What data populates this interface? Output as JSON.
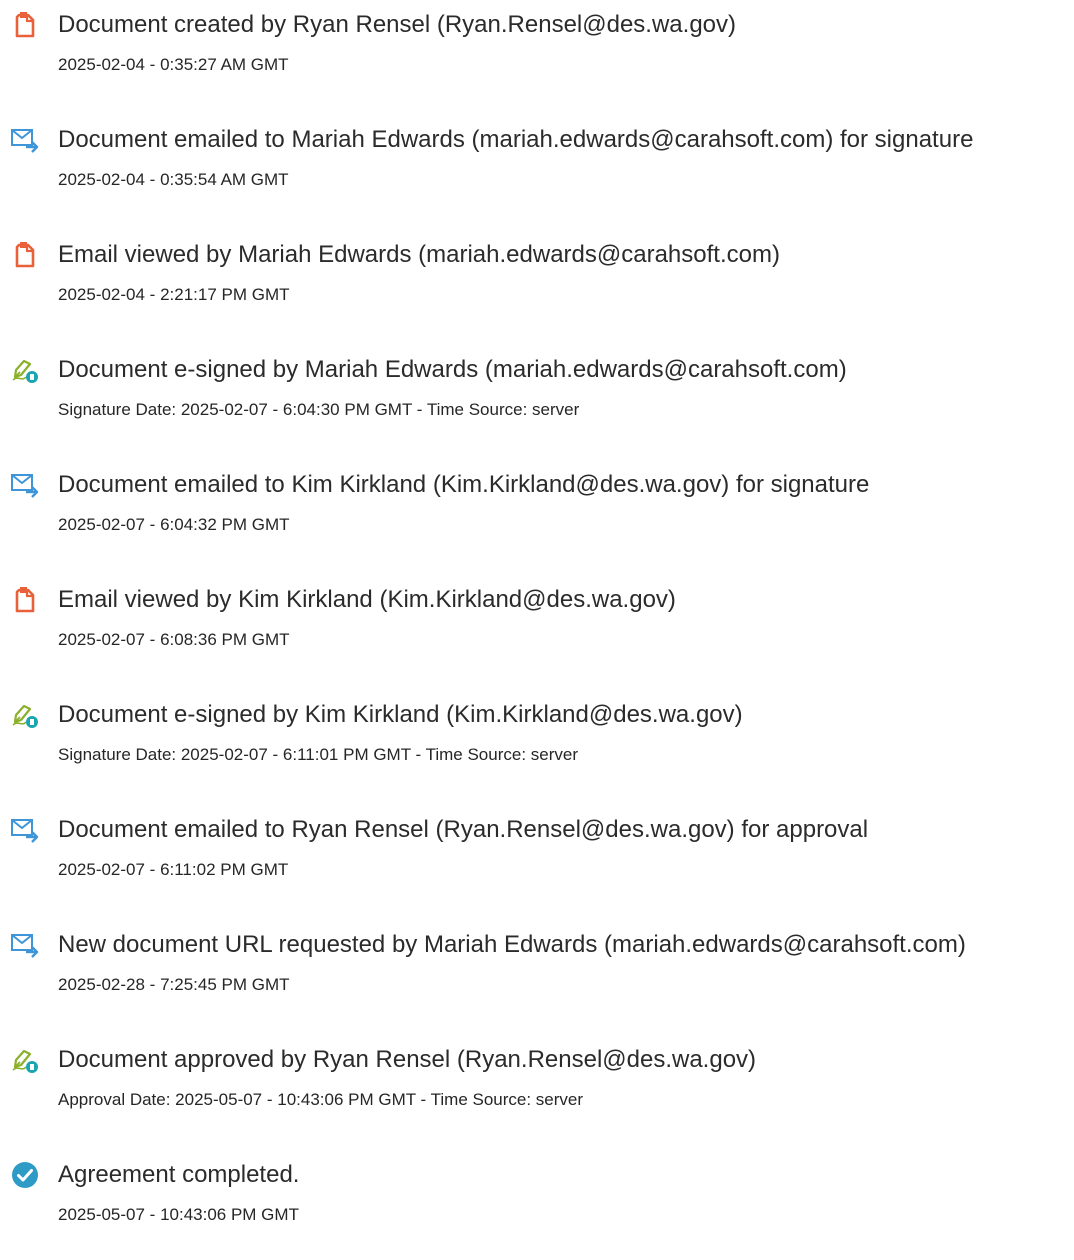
{
  "events": [
    {
      "icon": "document-icon",
      "title": "Document created by Ryan Rensel (Ryan.Rensel@des.wa.gov)",
      "time": "2025-02-04 - 0:35:27 AM GMT"
    },
    {
      "icon": "email-sent-icon",
      "title": "Document emailed to Mariah Edwards (mariah.edwards@carahsoft.com) for signature",
      "time": "2025-02-04 - 0:35:54 AM GMT"
    },
    {
      "icon": "document-icon",
      "title": "Email viewed by Mariah Edwards (mariah.edwards@carahsoft.com)",
      "time": "2025-02-04 - 2:21:17 PM GMT"
    },
    {
      "icon": "e-sign-pen-icon",
      "title": "Document e-signed by Mariah Edwards (mariah.edwards@carahsoft.com)",
      "time": "Signature Date: 2025-02-07 - 6:04:30 PM GMT - Time Source: server"
    },
    {
      "icon": "email-sent-icon",
      "title": "Document emailed to Kim Kirkland (Kim.Kirkland@des.wa.gov) for signature",
      "time": "2025-02-07 - 6:04:32 PM GMT"
    },
    {
      "icon": "document-icon",
      "title": "Email viewed by Kim Kirkland (Kim.Kirkland@des.wa.gov)",
      "time": "2025-02-07 - 6:08:36 PM GMT"
    },
    {
      "icon": "e-sign-pen-icon",
      "title": "Document e-signed by Kim Kirkland (Kim.Kirkland@des.wa.gov)",
      "time": "Signature Date: 2025-02-07 - 6:11:01 PM GMT - Time Source: server"
    },
    {
      "icon": "email-sent-icon",
      "title": "Document emailed to Ryan Rensel (Ryan.Rensel@des.wa.gov) for approval",
      "time": "2025-02-07 - 6:11:02 PM GMT"
    },
    {
      "icon": "email-sent-icon",
      "title": "New document URL requested by Mariah Edwards (mariah.edwards@carahsoft.com)",
      "time": "2025-02-28 - 7:25:45 PM GMT"
    },
    {
      "icon": "e-sign-pen-icon",
      "title": "Document approved by Ryan Rensel (Ryan.Rensel@des.wa.gov)",
      "time": "Approval Date: 2025-05-07 - 10:43:06 PM GMT - Time Source: server"
    },
    {
      "icon": "check-circle-icon",
      "title": "Agreement completed.",
      "time": "2025-05-07 - 10:43:06 PM GMT"
    }
  ],
  "colors": {
    "document_icon": "#e8613a",
    "email_icon": "#3e96d8",
    "sign_pen_icon": "#8bb02b",
    "sign_badge": "#1aa6b0",
    "check_icon": "#2e9bc6",
    "text": "#2b2b2b"
  }
}
